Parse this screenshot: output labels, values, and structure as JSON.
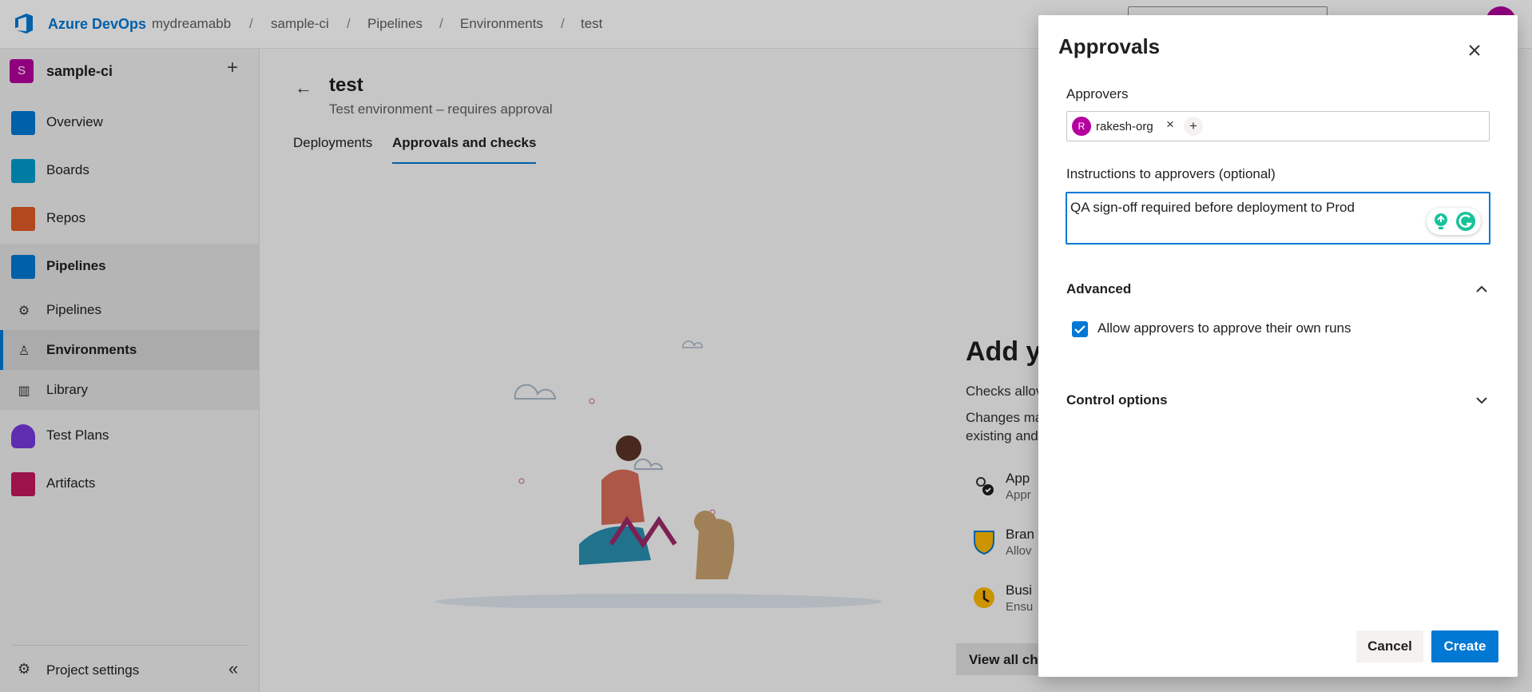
{
  "topbar": {
    "brand": "Azure DevOps",
    "breadcrumbs": [
      "mydreamabb",
      "sample-ci",
      "Pipelines",
      "Environments",
      "test"
    ],
    "separator": "/"
  },
  "sidebar": {
    "project_initial": "S",
    "project_name": "sample-ci",
    "add_symbol": "+",
    "items": [
      {
        "label": "Overview",
        "icon": "overview-icon",
        "color": "#0078d4"
      },
      {
        "label": "Boards",
        "icon": "boards-icon",
        "color": "#009ccc"
      },
      {
        "label": "Repos",
        "icon": "repos-icon",
        "color": "#e05a26"
      },
      {
        "label": "Pipelines",
        "icon": "pipelines-icon",
        "color": "#0078d4"
      }
    ],
    "sub_items": [
      {
        "label": "Pipelines",
        "icon": "pipelines-sub-icon"
      },
      {
        "label": "Environments",
        "icon": "environments-icon"
      },
      {
        "label": "Library",
        "icon": "library-icon"
      }
    ],
    "lower_items": [
      {
        "label": "Test Plans",
        "icon": "test-plans-icon",
        "color": "#773adc"
      },
      {
        "label": "Artifacts",
        "icon": "artifacts-icon",
        "color": "#c2185b"
      }
    ],
    "settings_label": "Project settings",
    "collapse_symbol": "«"
  },
  "main": {
    "back_symbol": "←",
    "title": "test",
    "subtitle": "Test environment – requires approval",
    "tabs": [
      "Deployments",
      "Approvals and checks"
    ],
    "active_tab": "Approvals and checks",
    "add_title": "Add y",
    "add_text_1": "Checks allov",
    "add_text_2": "Changes ma",
    "add_text_3": "existing and",
    "checks": [
      {
        "title": "App",
        "desc": "Appr",
        "icon": "approvals-icon"
      },
      {
        "title": "Bran",
        "desc": "Allov",
        "icon": "branch-control-icon"
      },
      {
        "title": "Busi",
        "desc": "Ensu",
        "icon": "business-hours-icon"
      }
    ],
    "view_all": "View all che"
  },
  "dialog": {
    "title": "Approvals",
    "approvers_label": "Approvers",
    "approver": {
      "initial": "R",
      "name": "rakesh-org"
    },
    "remove_symbol": "×",
    "add_symbol": "+",
    "instructions_label": "Instructions to approvers (optional)",
    "instructions_value": "QA sign-off required before deployment to Prod",
    "advanced_label": "Advanced",
    "advanced_expanded": true,
    "self_approve_label": "Allow approvers to approve their own runs",
    "self_approve_checked": true,
    "control_options_label": "Control options",
    "control_options_expanded": false,
    "cancel_label": "Cancel",
    "create_label": "Create"
  },
  "colors": {
    "accent": "#0078d4",
    "project_badge": "#b4009e"
  }
}
